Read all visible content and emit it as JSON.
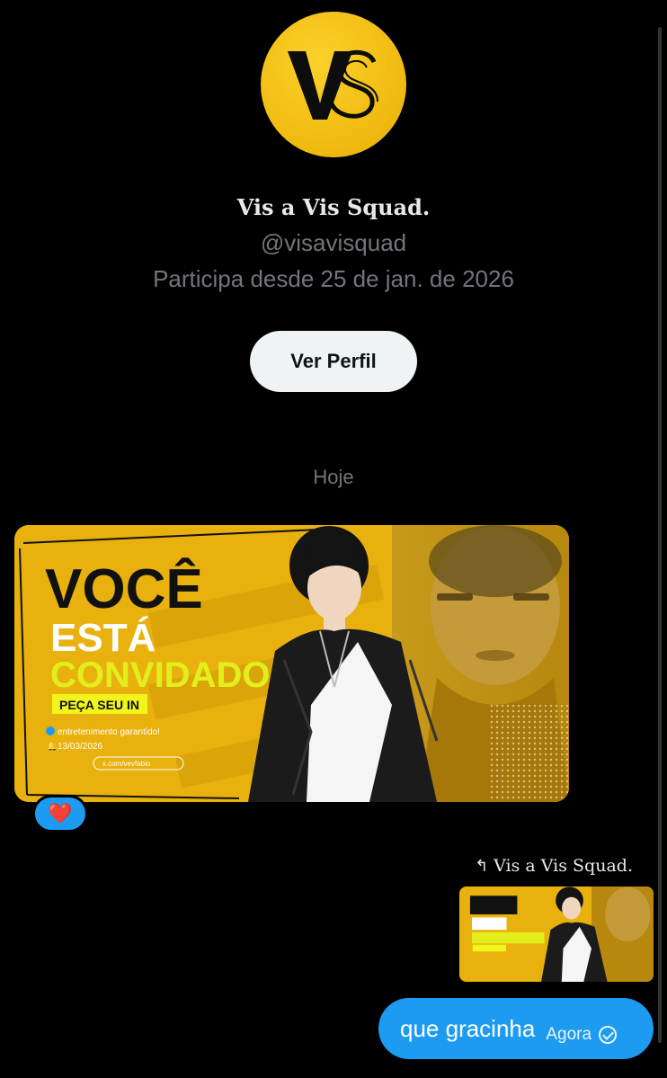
{
  "profile": {
    "avatar_text": "VS",
    "display_name": "Vis a Vis Squad.",
    "handle": "@visavisquad",
    "joined": "Participa desde 25 de jan. de 2026",
    "view_profile_label": "Ver Perfil"
  },
  "conversation": {
    "date_separator": "Hoje",
    "image_message": {
      "headline_1": "VOCÊ",
      "headline_2": "ESTÁ",
      "headline_3": "CONVIDADO",
      "cta": "PEÇA SEU IN",
      "tagline": "entretenimento garantido!",
      "date": "13/03/2026",
      "url": "x.com/vevfabio",
      "reaction": "❤️"
    },
    "reply": {
      "arrow": "↰",
      "reply_to": "Vis a Vis Squad."
    },
    "sent_message": {
      "text": "que gracinha",
      "time": "Agora"
    }
  },
  "colors": {
    "background": "#000000",
    "accent_blue": "#1d9bf0",
    "banner_yellow": "#e8b10d",
    "headline_green": "#e3ef1d"
  }
}
